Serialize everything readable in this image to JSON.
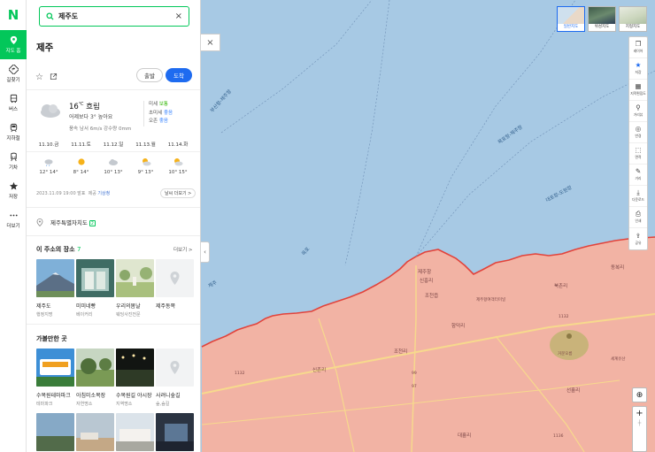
{
  "colors": {
    "accent": "#03c75a",
    "brand_blue": "#1e6bf0",
    "sea": "#a7c9e4",
    "land": "#f2b3a4",
    "border": "#e2433b"
  },
  "rail": {
    "logo": "N",
    "items": [
      {
        "label": "지도 홈",
        "icon": "map-pin-icon",
        "active": true
      },
      {
        "label": "길찾기",
        "icon": "directions-icon"
      },
      {
        "label": "버스",
        "icon": "bus-icon"
      },
      {
        "label": "지하철",
        "icon": "subway-icon"
      },
      {
        "label": "기차",
        "icon": "train-icon"
      },
      {
        "label": "저장",
        "icon": "star-save-icon"
      },
      {
        "label": "더보기",
        "icon": "more-dots-icon"
      }
    ]
  },
  "search": {
    "value": "제주도"
  },
  "place": {
    "title": "제주",
    "depart_label": "출발",
    "arrive_label": "도착"
  },
  "weather": {
    "temp": "16",
    "unit": "℃",
    "condition": "흐림",
    "compare": "어제보다 3° 높아요",
    "detail": "풍속 남서 6m/s  강수량 0mm",
    "air": [
      {
        "label": "미세",
        "value": "보통"
      },
      {
        "label": "초미세",
        "value": "좋음"
      },
      {
        "label": "오존",
        "value": "좋음"
      }
    ],
    "forecast": [
      {
        "day": "11.10.금",
        "icon": "rain-cloud-icon",
        "temp": "12° 14°"
      },
      {
        "day": "11.11.토",
        "icon": "sun-icon",
        "temp": "8° 14°"
      },
      {
        "day": "11.12.일",
        "icon": "cloud-icon",
        "temp": "10° 13°"
      },
      {
        "day": "11.13.월",
        "icon": "sun-cloud-icon",
        "temp": "9° 13°"
      },
      {
        "day": "11.14.화",
        "icon": "sun-cloud-icon",
        "temp": "10° 15°"
      }
    ],
    "source_time": "2023.11.09 19:00 발표",
    "source_prefix": "제공",
    "source_org": "기상청",
    "more_label": "날씨 더보기 >"
  },
  "address": {
    "text": "제주특별자치도",
    "badge": "2"
  },
  "places_section": {
    "title": "이 주소의 장소",
    "count": "7",
    "more": "더보기 >",
    "items": [
      {
        "name": "제주도",
        "category": "행정지명"
      },
      {
        "name": "미미네빵",
        "category": "베이커리"
      },
      {
        "name": "우리의봄날",
        "category": "웨딩사진전문"
      },
      {
        "name": "제주동쪽",
        "category": ""
      }
    ]
  },
  "visit_section": {
    "title": "가볼만한 곳",
    "items": [
      {
        "name": "수목원테마파크",
        "category": "테마파크"
      },
      {
        "name": "아침미소목장",
        "category": "자연명소"
      },
      {
        "name": "수목원길 야시장",
        "category": "지역명소"
      },
      {
        "name": "사려니숲길",
        "category": "숲,숲길"
      }
    ]
  },
  "layers": [
    {
      "label": "일반지도",
      "active": true
    },
    {
      "label": "위성지도"
    },
    {
      "label": "지형지도"
    }
  ],
  "toolbar": [
    {
      "label": "레이어",
      "icon": "layers-icon"
    },
    {
      "label": "저장",
      "icon": "star-icon",
      "blue": true
    },
    {
      "label": "지적편집도",
      "icon": "cadastral-icon"
    },
    {
      "label": "거리뷰",
      "icon": "street-view-icon"
    },
    {
      "label": "반경",
      "icon": "radius-icon"
    },
    {
      "label": "면적",
      "icon": "area-icon"
    },
    {
      "label": "거리",
      "icon": "ruler-icon"
    },
    {
      "label": "다운로드",
      "icon": "download-icon"
    },
    {
      "label": "인쇄",
      "icon": "print-icon"
    },
    {
      "label": "공유",
      "icon": "share-icon"
    }
  ],
  "map_labels": {
    "sea": [
      "부산항-제주항",
      "목포항-제주항",
      "대포항-도원항",
      "우도항",
      "제주",
      "목포"
    ],
    "land": [
      "제주항",
      "신흥리",
      "북촌리",
      "동복리",
      "함덕리",
      "와흘리",
      "신촌리",
      "조천리",
      "선흘리",
      "대흘리",
      "제주항여객터미널",
      "조천읍",
      "거문오름",
      "세계유산",
      "1132",
      "1136",
      "1118",
      "99",
      "97"
    ]
  }
}
